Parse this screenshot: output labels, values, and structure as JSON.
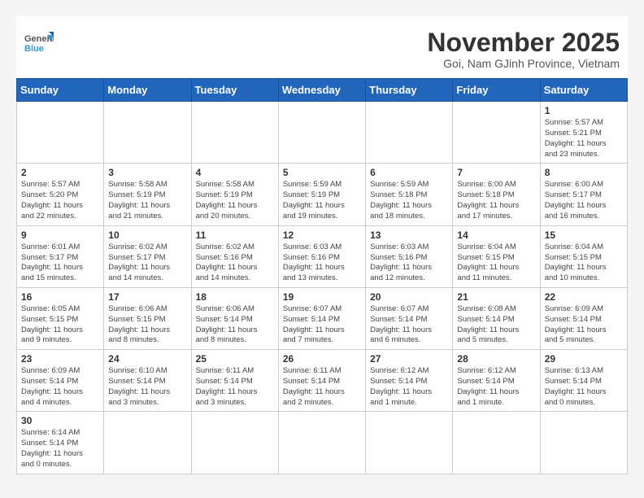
{
  "header": {
    "logo_general": "General",
    "logo_blue": "Blue",
    "month": "November 2025",
    "location": "Goi, Nam GJinh Province, Vietnam"
  },
  "weekdays": [
    "Sunday",
    "Monday",
    "Tuesday",
    "Wednesday",
    "Thursday",
    "Friday",
    "Saturday"
  ],
  "weeks": [
    [
      {
        "day": "",
        "info": ""
      },
      {
        "day": "",
        "info": ""
      },
      {
        "day": "",
        "info": ""
      },
      {
        "day": "",
        "info": ""
      },
      {
        "day": "",
        "info": ""
      },
      {
        "day": "",
        "info": ""
      },
      {
        "day": "1",
        "info": "Sunrise: 5:57 AM\nSunset: 5:21 PM\nDaylight: 11 hours\nand 23 minutes."
      }
    ],
    [
      {
        "day": "2",
        "info": "Sunrise: 5:57 AM\nSunset: 5:20 PM\nDaylight: 11 hours\nand 22 minutes."
      },
      {
        "day": "3",
        "info": "Sunrise: 5:58 AM\nSunset: 5:19 PM\nDaylight: 11 hours\nand 21 minutes."
      },
      {
        "day": "4",
        "info": "Sunrise: 5:58 AM\nSunset: 5:19 PM\nDaylight: 11 hours\nand 20 minutes."
      },
      {
        "day": "5",
        "info": "Sunrise: 5:59 AM\nSunset: 5:19 PM\nDaylight: 11 hours\nand 19 minutes."
      },
      {
        "day": "6",
        "info": "Sunrise: 5:59 AM\nSunset: 5:18 PM\nDaylight: 11 hours\nand 18 minutes."
      },
      {
        "day": "7",
        "info": "Sunrise: 6:00 AM\nSunset: 5:18 PM\nDaylight: 11 hours\nand 17 minutes."
      },
      {
        "day": "8",
        "info": "Sunrise: 6:00 AM\nSunset: 5:17 PM\nDaylight: 11 hours\nand 16 minutes."
      }
    ],
    [
      {
        "day": "9",
        "info": "Sunrise: 6:01 AM\nSunset: 5:17 PM\nDaylight: 11 hours\nand 15 minutes."
      },
      {
        "day": "10",
        "info": "Sunrise: 6:02 AM\nSunset: 5:17 PM\nDaylight: 11 hours\nand 14 minutes."
      },
      {
        "day": "11",
        "info": "Sunrise: 6:02 AM\nSunset: 5:16 PM\nDaylight: 11 hours\nand 14 minutes."
      },
      {
        "day": "12",
        "info": "Sunrise: 6:03 AM\nSunset: 5:16 PM\nDaylight: 11 hours\nand 13 minutes."
      },
      {
        "day": "13",
        "info": "Sunrise: 6:03 AM\nSunset: 5:16 PM\nDaylight: 11 hours\nand 12 minutes."
      },
      {
        "day": "14",
        "info": "Sunrise: 6:04 AM\nSunset: 5:15 PM\nDaylight: 11 hours\nand 11 minutes."
      },
      {
        "day": "15",
        "info": "Sunrise: 6:04 AM\nSunset: 5:15 PM\nDaylight: 11 hours\nand 10 minutes."
      }
    ],
    [
      {
        "day": "16",
        "info": "Sunrise: 6:05 AM\nSunset: 5:15 PM\nDaylight: 11 hours\nand 9 minutes."
      },
      {
        "day": "17",
        "info": "Sunrise: 6:06 AM\nSunset: 5:15 PM\nDaylight: 11 hours\nand 8 minutes."
      },
      {
        "day": "18",
        "info": "Sunrise: 6:06 AM\nSunset: 5:14 PM\nDaylight: 11 hours\nand 8 minutes."
      },
      {
        "day": "19",
        "info": "Sunrise: 6:07 AM\nSunset: 5:14 PM\nDaylight: 11 hours\nand 7 minutes."
      },
      {
        "day": "20",
        "info": "Sunrise: 6:07 AM\nSunset: 5:14 PM\nDaylight: 11 hours\nand 6 minutes."
      },
      {
        "day": "21",
        "info": "Sunrise: 6:08 AM\nSunset: 5:14 PM\nDaylight: 11 hours\nand 5 minutes."
      },
      {
        "day": "22",
        "info": "Sunrise: 6:09 AM\nSunset: 5:14 PM\nDaylight: 11 hours\nand 5 minutes."
      }
    ],
    [
      {
        "day": "23",
        "info": "Sunrise: 6:09 AM\nSunset: 5:14 PM\nDaylight: 11 hours\nand 4 minutes."
      },
      {
        "day": "24",
        "info": "Sunrise: 6:10 AM\nSunset: 5:14 PM\nDaylight: 11 hours\nand 3 minutes."
      },
      {
        "day": "25",
        "info": "Sunrise: 6:11 AM\nSunset: 5:14 PM\nDaylight: 11 hours\nand 3 minutes."
      },
      {
        "day": "26",
        "info": "Sunrise: 6:11 AM\nSunset: 5:14 PM\nDaylight: 11 hours\nand 2 minutes."
      },
      {
        "day": "27",
        "info": "Sunrise: 6:12 AM\nSunset: 5:14 PM\nDaylight: 11 hours\nand 1 minute."
      },
      {
        "day": "28",
        "info": "Sunrise: 6:12 AM\nSunset: 5:14 PM\nDaylight: 11 hours\nand 1 minute."
      },
      {
        "day": "29",
        "info": "Sunrise: 6:13 AM\nSunset: 5:14 PM\nDaylight: 11 hours\nand 0 minutes."
      }
    ],
    [
      {
        "day": "30",
        "info": "Sunrise: 6:14 AM\nSunset: 5:14 PM\nDaylight: 11 hours\nand 0 minutes."
      },
      {
        "day": "",
        "info": ""
      },
      {
        "day": "",
        "info": ""
      },
      {
        "day": "",
        "info": ""
      },
      {
        "day": "",
        "info": ""
      },
      {
        "day": "",
        "info": ""
      },
      {
        "day": "",
        "info": ""
      }
    ]
  ]
}
